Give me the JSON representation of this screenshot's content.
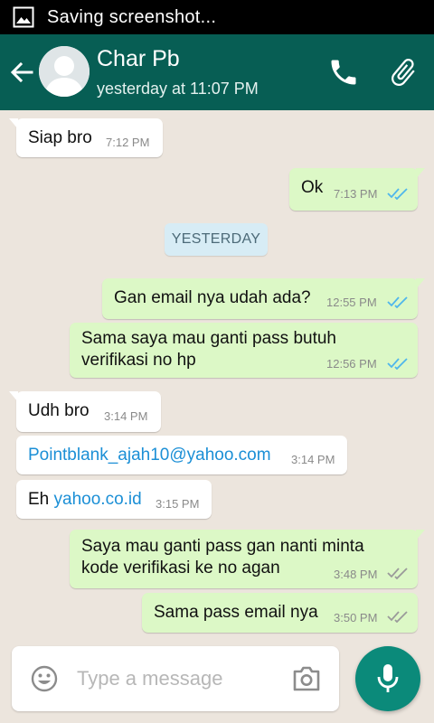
{
  "status_bar": {
    "text": "Saving screenshot..."
  },
  "header": {
    "contact_name": "Char Pb",
    "last_seen": "yesterday at 11:07 PM",
    "icons": [
      "back-arrow-icon",
      "avatar",
      "phone-icon",
      "attach-icon"
    ]
  },
  "date_separator": "YESTERDAY",
  "messages": [
    {
      "direction": "in",
      "text": "Siap bro",
      "time": "7:12 PM"
    },
    {
      "direction": "out",
      "text": "Ok",
      "time": "7:13 PM",
      "status": "read"
    },
    {
      "direction": "out",
      "text": "Gan email nya udah ada?",
      "time": "12:55 PM",
      "status": "read"
    },
    {
      "direction": "out",
      "line1": "Sama saya mau ganti pass butuh",
      "line2": "verifikasi no hp",
      "time": "12:56 PM",
      "status": "read"
    },
    {
      "direction": "in",
      "text": "Udh bro",
      "time": "3:14 PM"
    },
    {
      "direction": "in",
      "text": "Pointblank_ajah10@yahoo.com",
      "time": "3:14 PM",
      "is_link": true
    },
    {
      "direction": "in",
      "prefix": "Eh ",
      "link": "yahoo.co.id",
      "time": "3:15 PM"
    },
    {
      "direction": "out",
      "line1": "Saya mau ganti pass gan nanti minta",
      "line2": "kode verifikasi ke no agan",
      "time": "3:48 PM",
      "status": "delivered"
    },
    {
      "direction": "out",
      "text": "Sama pass email nya",
      "time": "3:50 PM",
      "status": "delivered"
    }
  ],
  "composer": {
    "placeholder": "Type a message"
  },
  "colors": {
    "app_bar": "#075e54",
    "outgoing_bubble": "#dcf8c6",
    "incoming_bubble": "#ffffff",
    "chat_background": "#ece5dd",
    "read_ticks": "#4fb6ec",
    "delivered_ticks": "#9a9a9a",
    "fab": "#0b8a7a",
    "link": "#1b8fd6"
  }
}
